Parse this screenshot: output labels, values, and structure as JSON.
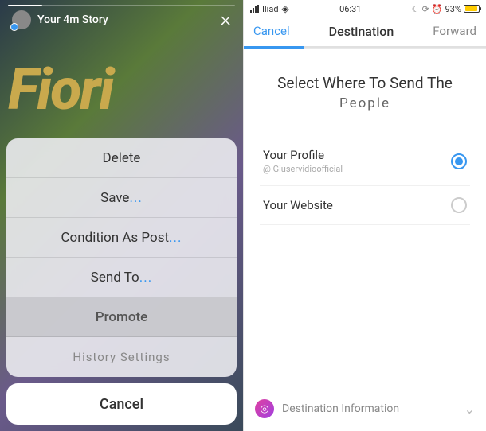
{
  "left": {
    "bg_word": "Fiori",
    "story_label": "Your 4m Story",
    "sheet": {
      "delete": "Delete",
      "save": "Save",
      "condition": "Condition As Post",
      "send": "Send To",
      "promote": "Promote",
      "history": "History Settings"
    },
    "cancel": "Cancel",
    "dots": "..."
  },
  "right": {
    "status": {
      "carrier": "Iliad",
      "time": "06:31",
      "battery_pct": "93%"
    },
    "nav": {
      "cancel": "Cancel",
      "title": "Destination",
      "forward": "Forward"
    },
    "heading_line1": "Select Where To Send The",
    "heading_line2": "People",
    "options": [
      {
        "title": "Your Profile",
        "sub": "@ Giuservidioofficial",
        "selected": true
      },
      {
        "title": "Your Website",
        "sub": "",
        "selected": false
      }
    ],
    "footer": "Destination Information"
  }
}
